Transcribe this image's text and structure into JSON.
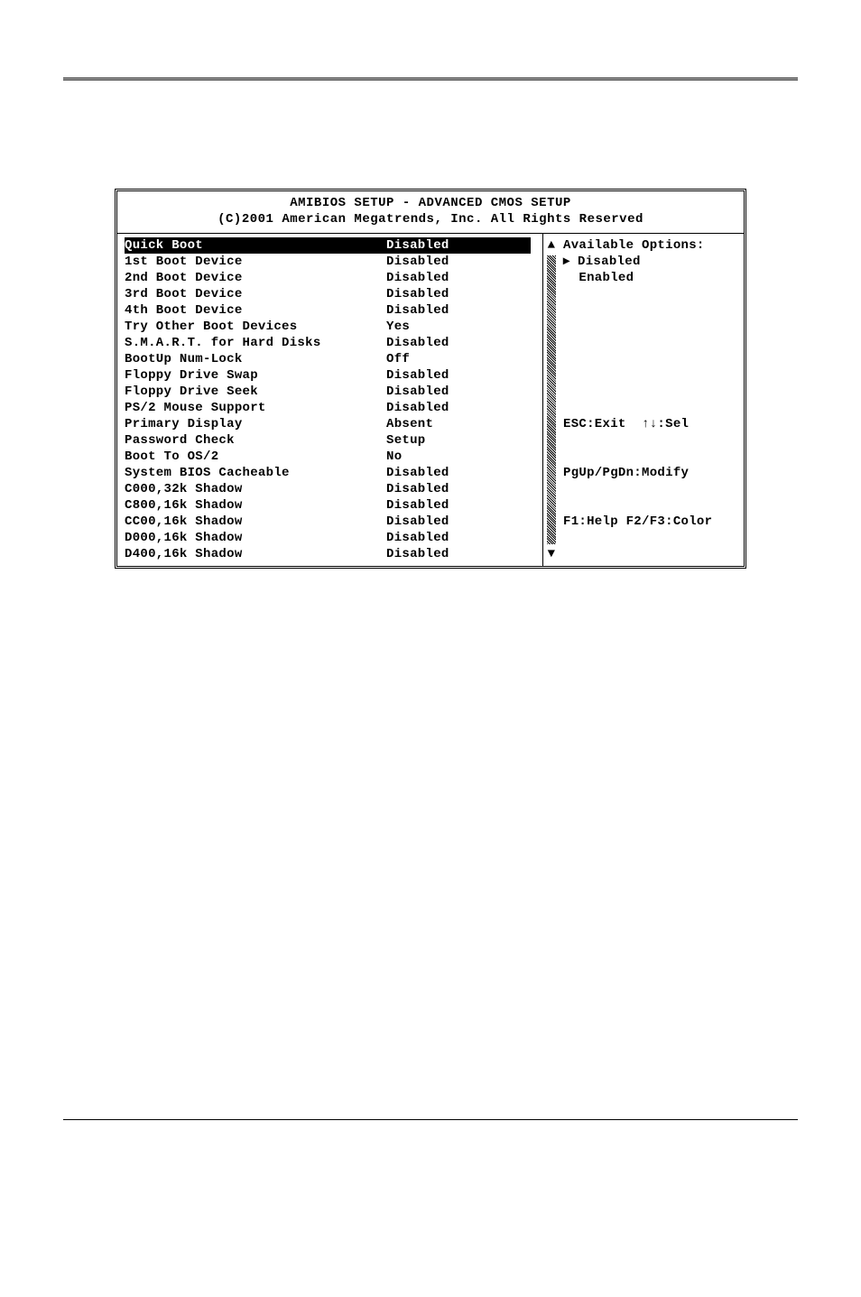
{
  "header": {
    "title": "AMIBIOS SETUP - ADVANCED CMOS SETUP",
    "copyright": "(C)2001 American Megatrends, Inc. All Rights Reserved"
  },
  "settings": [
    {
      "label": "Quick Boot",
      "value": "Disabled",
      "selected": true
    },
    {
      "label": "1st Boot Device",
      "value": "Disabled",
      "selected": false
    },
    {
      "label": "2nd Boot Device",
      "value": "Disabled",
      "selected": false
    },
    {
      "label": "3rd Boot Device",
      "value": "Disabled",
      "selected": false
    },
    {
      "label": "4th Boot Device",
      "value": "Disabled",
      "selected": false
    },
    {
      "label": "Try Other Boot Devices",
      "value": "Yes",
      "selected": false
    },
    {
      "label": "S.M.A.R.T. for Hard Disks",
      "value": "Disabled",
      "selected": false
    },
    {
      "label": "BootUp Num-Lock",
      "value": "Off",
      "selected": false
    },
    {
      "label": "Floppy Drive Swap",
      "value": "Disabled",
      "selected": false
    },
    {
      "label": "Floppy Drive Seek",
      "value": "Disabled",
      "selected": false
    },
    {
      "label": "PS/2 Mouse Support",
      "value": "Disabled",
      "selected": false
    },
    {
      "label": "Primary Display",
      "value": "Absent",
      "selected": false
    },
    {
      "label": "Password Check",
      "value": "Setup",
      "selected": false
    },
    {
      "label": "Boot To OS/2",
      "value": "No",
      "selected": false
    },
    {
      "label": "System BIOS Cacheable",
      "value": "Disabled",
      "selected": false
    },
    {
      "label": "C000,32k Shadow",
      "value": "Disabled",
      "selected": false
    },
    {
      "label": "C800,16k Shadow",
      "value": "Disabled",
      "selected": false
    },
    {
      "label": "CC00,16k Shadow",
      "value": "Disabled",
      "selected": false
    },
    {
      "label": "D000,16k Shadow",
      "value": "Disabled",
      "selected": false
    },
    {
      "label": "D400,16k Shadow",
      "value": "Disabled",
      "selected": false
    }
  ],
  "options": {
    "heading": "Available Options:",
    "items": [
      {
        "text": "Disabled",
        "marker": "▸"
      },
      {
        "text": "Enabled",
        "marker": " "
      }
    ]
  },
  "footer_keys": {
    "line1": "ESC:Exit  ↑↓:Sel",
    "line2": "PgUp/PgDn:Modify",
    "line3": "F1:Help F2/F3:Color"
  },
  "scroll": {
    "up_arrow": "▲",
    "down_arrow": "▼"
  }
}
